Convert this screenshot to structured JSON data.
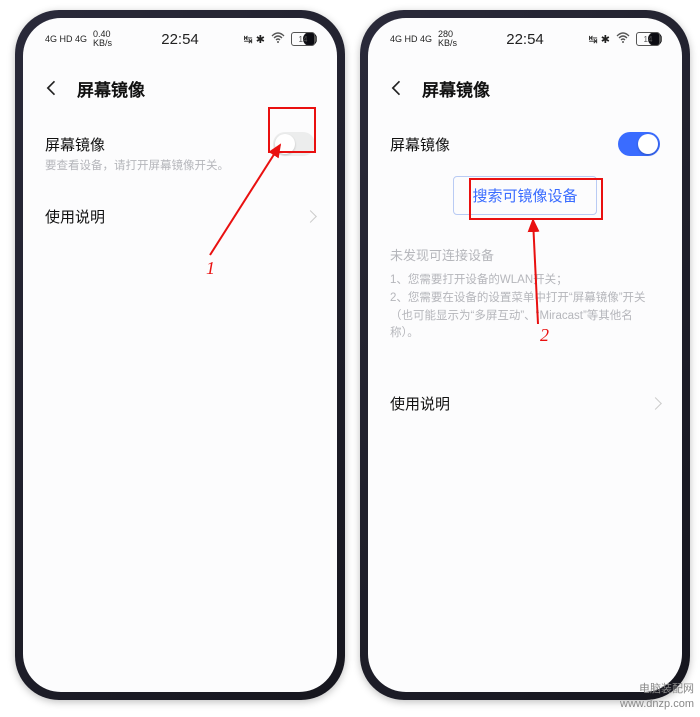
{
  "status": {
    "net_left": "4G HD  4G",
    "speed_left": "0.40\nKB/s",
    "speed_right": "280\nKB/s",
    "time": "22:54",
    "bt": "↹ ✱",
    "battery": "14"
  },
  "header": {
    "title": "屏幕镜像"
  },
  "left": {
    "row_label": "屏幕镜像",
    "sub": "要查看设备，请打开屏幕镜像开关。",
    "instructions_label": "使用说明"
  },
  "right": {
    "row_label": "屏幕镜像",
    "search_btn": "搜索可镜像设备",
    "not_found": "未发现可连接设备",
    "tip1": "1、您需要打开设备的WLAN开关；",
    "tip2": "2、您需要在设备的设置菜单中打开“屏幕镜像”开关（也可能显示为“多屏互动”、“Miracast”等其他名称）。",
    "instructions_label": "使用说明"
  },
  "annot": {
    "step1": "1",
    "step2": "2"
  },
  "watermark": {
    "l1": "电脑装配网",
    "l2": "www.dnzp.com"
  }
}
